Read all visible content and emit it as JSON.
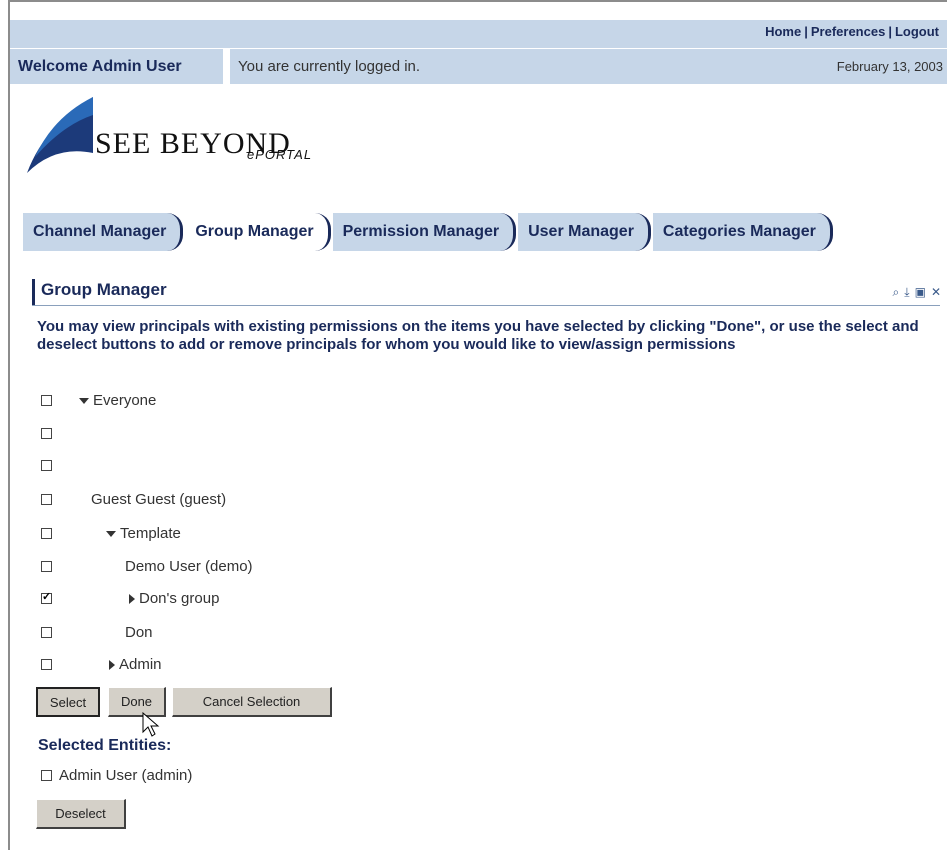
{
  "header": {
    "links": [
      "Home",
      "Preferences",
      "Logout"
    ],
    "welcome": "Welcome Admin User",
    "status": "You are currently logged in.",
    "date": "February 13, 2003"
  },
  "logo": {
    "main_text": "SEE BEYOND",
    "sub_text": "ePORTAL"
  },
  "tabs": [
    {
      "label": "Channel Manager",
      "active": false
    },
    {
      "label": "Group Manager",
      "active": true
    },
    {
      "label": "Permission Manager",
      "active": false
    },
    {
      "label": "User Manager",
      "active": false
    },
    {
      "label": "Categories Manager",
      "active": false
    }
  ],
  "portlet": {
    "title": "Group Manager",
    "icons": [
      "search-icon",
      "download-icon",
      "edit-icon",
      "close-icon"
    ],
    "instructions": "You may view principals with existing permissions on the items you have selected by clicking \"Done\", or use the select and deselect buttons to add or remove principals for whom you would like to view/assign permissions"
  },
  "tree": [
    {
      "label": "Everyone",
      "checked": false,
      "expander": "expanded"
    },
    {
      "label": "",
      "checked": false,
      "expander": "none"
    },
    {
      "label": "",
      "checked": false,
      "expander": "none"
    },
    {
      "label": "Guest Guest (guest)",
      "checked": false,
      "expander": "none"
    },
    {
      "label": "Template",
      "checked": false,
      "expander": "expanded"
    },
    {
      "label": "Demo User (demo)",
      "checked": false,
      "expander": "none"
    },
    {
      "label": "Don's group",
      "checked": true,
      "expander": "collapsed"
    },
    {
      "label": "Don",
      "checked": false,
      "expander": "none"
    },
    {
      "label": "Admin",
      "checked": false,
      "expander": "collapsed"
    }
  ],
  "buttons": {
    "select": "Select",
    "done": "Done",
    "cancel": "Cancel Selection",
    "deselect": "Deselect"
  },
  "selected": {
    "heading": "Selected Entities:",
    "items": [
      {
        "label": "Admin User (admin)",
        "checked": false
      }
    ]
  }
}
